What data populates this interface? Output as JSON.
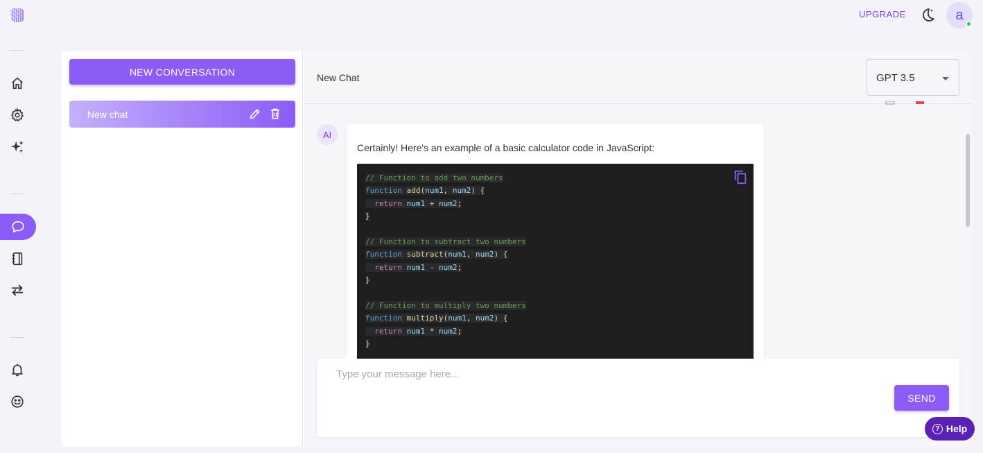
{
  "topbar": {
    "upgrade_label": "UPGRADE",
    "avatar_letter": "a",
    "online_color": "#22c55e"
  },
  "rail": {
    "items": [
      {
        "icon": "home-icon"
      },
      {
        "icon": "gear-icon"
      },
      {
        "icon": "sparkles-icon"
      },
      {
        "icon": "chat-bubble-icon",
        "active": true
      },
      {
        "icon": "notebook-icon"
      },
      {
        "icon": "swap-arrows-icon"
      },
      {
        "icon": "bell-icon"
      },
      {
        "icon": "smiley-icon"
      }
    ]
  },
  "sidebar": {
    "new_conversation_label": "NEW CONVERSATION",
    "conversations": [
      {
        "title": "New chat"
      }
    ]
  },
  "chat": {
    "title": "New Chat",
    "model": "GPT 3.5",
    "ai_label": "AI",
    "message_intro": "Certainly! Here's an example of a basic calculator code in JavaScript:",
    "code_lines": [
      "// Function to add two numbers",
      "function add(num1, num2) {",
      "  return num1 + num2;",
      "}",
      "",
      "// Function to subtract two numbers",
      "function subtract(num1, num2) {",
      "  return num1 - num2;",
      "}",
      "",
      "// Function to multiply two numbers",
      "function multiply(num1, num2) {",
      "  return num1 * num2;",
      "}"
    ]
  },
  "composer": {
    "placeholder": "Type your message here...",
    "value": "",
    "send_label": "SEND"
  },
  "help": {
    "label": "Help"
  },
  "colors": {
    "accent": "#8b5cf6",
    "accent_dark": "#7c3aed",
    "help_bg": "#5b21b6",
    "code_bg": "#1e1e1e"
  }
}
